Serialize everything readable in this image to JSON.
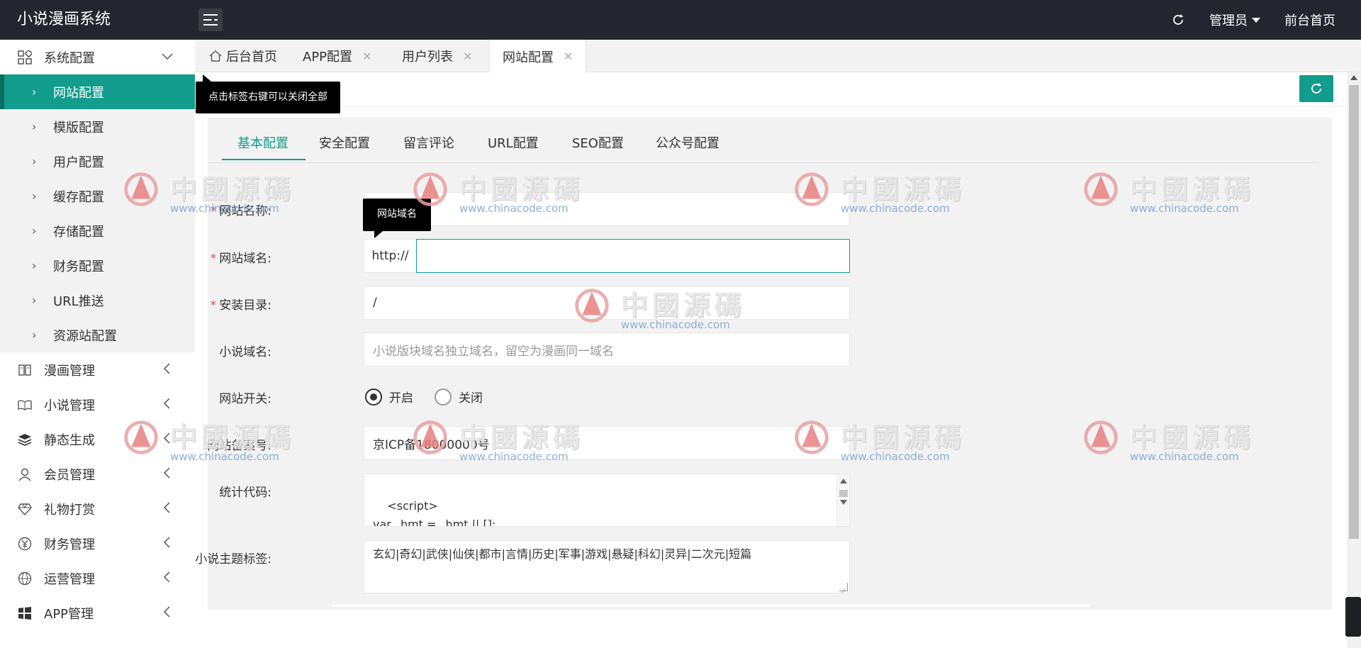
{
  "header": {
    "logo": "小说漫画系统",
    "admin_label": "管理员",
    "front_link": "前台首页"
  },
  "sidebar": {
    "system": {
      "label": "系统配置",
      "items": [
        {
          "label": "网站配置"
        },
        {
          "label": "模版配置"
        },
        {
          "label": "用户配置"
        },
        {
          "label": "缓存配置"
        },
        {
          "label": "存储配置"
        },
        {
          "label": "财务配置"
        },
        {
          "label": "URL推送"
        },
        {
          "label": "资源站配置"
        }
      ]
    },
    "groups": [
      {
        "label": "漫画管理"
      },
      {
        "label": "小说管理"
      },
      {
        "label": "静态生成"
      },
      {
        "label": "会员管理"
      },
      {
        "label": "礼物打赏"
      },
      {
        "label": "财务管理"
      },
      {
        "label": "运营管理"
      },
      {
        "label": "APP管理"
      }
    ]
  },
  "tabs": [
    {
      "label": "后台首页"
    },
    {
      "label": "APP配置"
    },
    {
      "label": "用户列表"
    },
    {
      "label": "网站配置"
    }
  ],
  "tooltips": {
    "tab_hint": "点击标签右键可以关闭全部",
    "field_hint": "网站域名"
  },
  "inner_tabs": [
    {
      "label": "基本配置"
    },
    {
      "label": "安全配置"
    },
    {
      "label": "留言评论"
    },
    {
      "label": "URL配置"
    },
    {
      "label": "SEO配置"
    },
    {
      "label": "公众号配置"
    }
  ],
  "form": {
    "site_name": {
      "label": "网站名称:",
      "value": ""
    },
    "site_domain": {
      "label": "网站域名:",
      "prefix": "http://",
      "value": ""
    },
    "install_dir": {
      "label": "安装目录:",
      "value": "/"
    },
    "novel_domain": {
      "label": "小说域名:",
      "placeholder": "小说版块域名独立域名，留空为漫画同一域名"
    },
    "site_switch": {
      "label": "网站开关:",
      "on": "开启",
      "off": "关闭"
    },
    "icp": {
      "label": "网站备案号:",
      "value": "京ICP备18000000号"
    },
    "stat_code": {
      "label": "统计代码:",
      "value": "<script>\nvar _hmt = _hmt || [];\n(function() {"
    },
    "novel_tags": {
      "label": "小说主题标签:",
      "value": "玄幻|奇幻|武侠|仙侠|都市|言情|历史|军事|游戏|悬疑|科幻|灵异|二次元|短篇"
    }
  },
  "watermark": {
    "cn": "中國源碼",
    "url": "www.chinacode.com"
  },
  "colors": {
    "accent": "#119c8c",
    "header_bg": "#23262e"
  }
}
